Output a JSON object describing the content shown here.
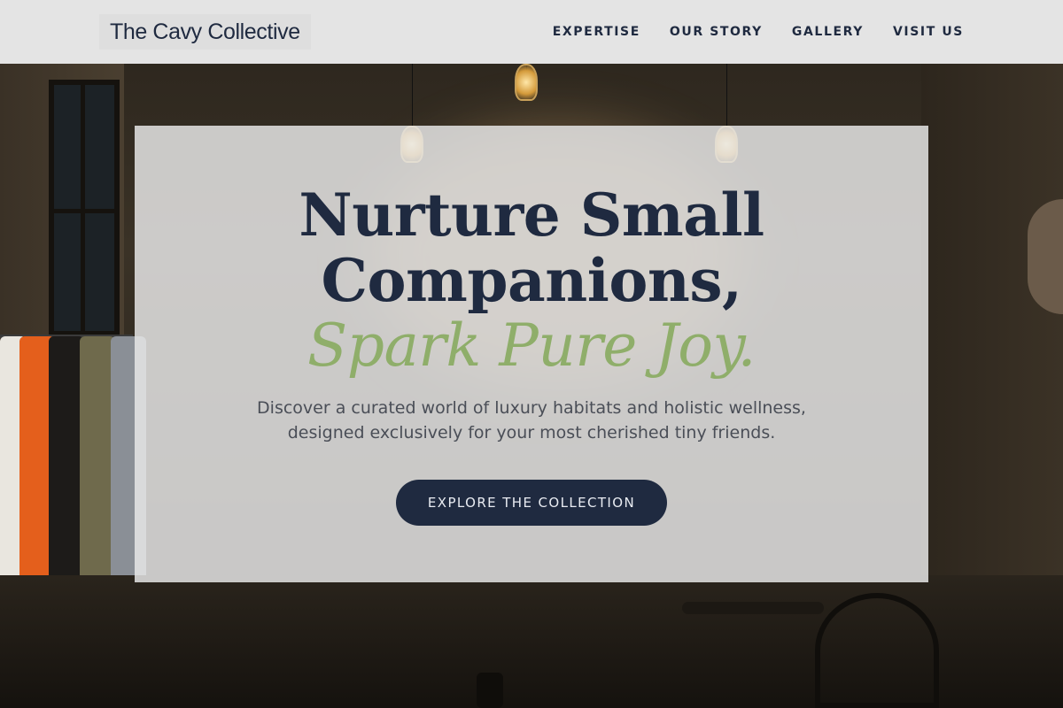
{
  "brand": {
    "name": "The Cavy Collective"
  },
  "nav": {
    "items": [
      {
        "label": "EXPERTISE"
      },
      {
        "label": "OUR STORY"
      },
      {
        "label": "GALLERY"
      },
      {
        "label": "VISIT US"
      }
    ]
  },
  "hero": {
    "title_line1": "Nurture Small",
    "title_line2": "Companions,",
    "title_accent": "Spark Pure Joy.",
    "subtitle": "Discover a curated world of luxury habitats and holistic wellness, designed exclusively for your most cherished tiny friends.",
    "cta_label": "EXPLORE THE COLLECTION"
  },
  "colors": {
    "navy": "#1f2a40",
    "sage": "#8fae6a",
    "header_bg": "#ececec",
    "card_bg": "#e8e8e8"
  }
}
